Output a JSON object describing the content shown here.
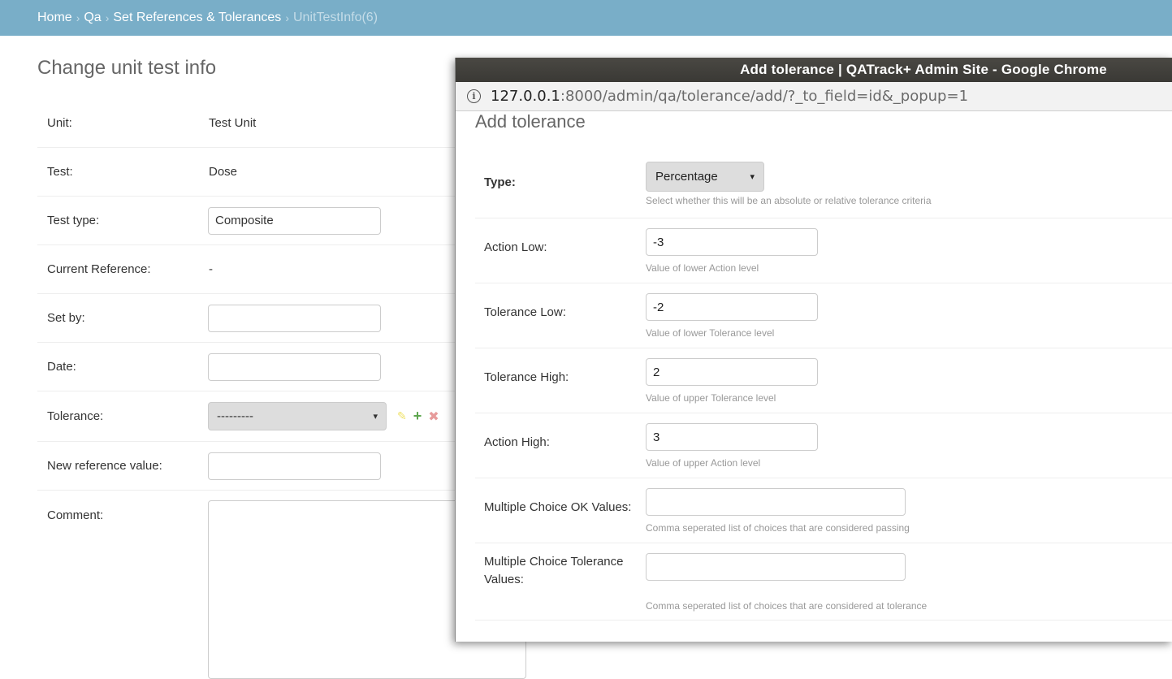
{
  "breadcrumbs": {
    "items": [
      "Home",
      "Qa",
      "Set References & Tolerances"
    ],
    "current": "UnitTestInfo(6)",
    "separator": "›"
  },
  "main": {
    "title": "Change unit test info",
    "unit": {
      "label": "Unit:",
      "value": "Test Unit"
    },
    "test": {
      "label": "Test:",
      "value": "Dose"
    },
    "test_type": {
      "label": "Test type:",
      "value": "Composite"
    },
    "current_reference": {
      "label": "Current Reference:",
      "value": "-"
    },
    "set_by": {
      "label": "Set by:",
      "value": ""
    },
    "date": {
      "label": "Date:",
      "value": ""
    },
    "tolerance": {
      "label": "Tolerance:",
      "selected": "---------",
      "arrow": "▾"
    },
    "new_reference": {
      "label": "New reference value:",
      "value": ""
    },
    "comment": {
      "label": "Comment:"
    }
  },
  "icons": {
    "pencil": "pencil-icon",
    "plus": "plus-icon",
    "delete": "delete-icon"
  },
  "popup": {
    "window_title": "Add tolerance | QATrack+ Admin Site - Google Chrome",
    "url_host": "127.0.0.1",
    "url_rest": ":8000/admin/qa/tolerance/add/?_to_field=id&_popup=1",
    "title": "Add tolerance",
    "type": {
      "label": "Type:",
      "selected": "Percentage",
      "arrow": "▾",
      "help": "Select whether this will be an absolute or relative tolerance criteria"
    },
    "action_low": {
      "label": "Action Low:",
      "value": "-3",
      "help": "Value of lower Action level"
    },
    "tolerance_low": {
      "label": "Tolerance Low:",
      "value": "-2",
      "help": "Value of lower Tolerance level"
    },
    "tolerance_high": {
      "label": "Tolerance High:",
      "value": "2",
      "help": "Value of upper Tolerance level"
    },
    "action_high": {
      "label": "Action High:",
      "value": "3",
      "help": "Value of upper Action level"
    },
    "mc_ok": {
      "label": "Multiple Choice OK Values:",
      "value": "",
      "help": "Comma seperated list of choices that are considered passing"
    },
    "mc_tol": {
      "label": "Multiple Choice Tolerance Values:",
      "value": "",
      "help": "Comma seperated list of choices that are considered at tolerance"
    }
  },
  "colors": {
    "breadcrumb_bg": "#79aec8",
    "titlebar_bg": "#3f3e3a",
    "help_text": "#999999"
  }
}
